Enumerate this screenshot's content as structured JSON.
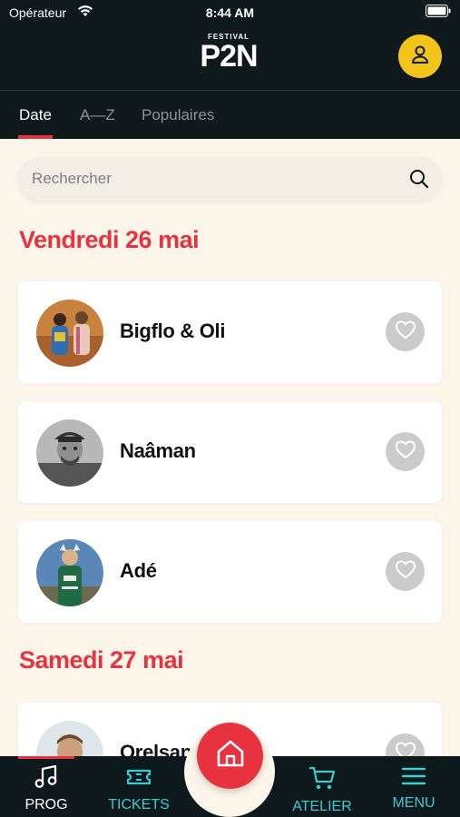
{
  "status_bar": {
    "carrier": "Opérateur",
    "time": "8:44 AM"
  },
  "header": {
    "logo_sup": "FESTIVAL",
    "logo_main": "P2N"
  },
  "tabs": [
    {
      "label": "Date",
      "active": true
    },
    {
      "label": "A—Z",
      "active": false
    },
    {
      "label": "Populaires",
      "active": false
    }
  ],
  "search": {
    "placeholder": "Rechercher"
  },
  "days": [
    {
      "heading": "Vendredi 26 mai",
      "artists": [
        {
          "name": "Bigflo & Oli"
        },
        {
          "name": "Naâman"
        },
        {
          "name": "Adé"
        }
      ]
    },
    {
      "heading": "Samedi 27 mai",
      "artists": [
        {
          "name": "Orelsan"
        }
      ]
    }
  ],
  "bottom_nav": {
    "prog": "PROG",
    "tickets": "TICKETS",
    "atelier": "ATELIER",
    "menu": "MENU"
  },
  "colors": {
    "accent": "#e9323f",
    "header_bg": "#0e191b",
    "teal": "#3ccbd3",
    "avatar": "#f3c41a",
    "page_bg": "#fbf6e9"
  }
}
